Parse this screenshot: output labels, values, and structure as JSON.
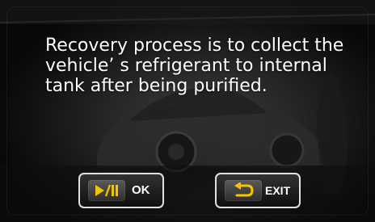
{
  "message": {
    "text": "Recovery process is to collect the vehicle’ s refrigerant to internal tank after being purified."
  },
  "buttons": {
    "ok": {
      "label": "OK",
      "icon": "play-pause-icon",
      "icon_color": "#f5c400"
    },
    "exit": {
      "label": "EXIT",
      "icon": "return-arrow-icon",
      "icon_color": "#f5c400"
    }
  },
  "colors": {
    "text": "#ffffff",
    "button_border": "#e2e2e2",
    "accent": "#f5c400"
  }
}
